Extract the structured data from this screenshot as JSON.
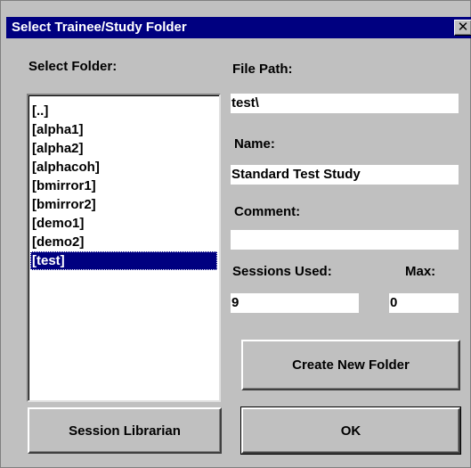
{
  "window": {
    "title": "Select Trainee/Study Folder",
    "close_glyph": "✕"
  },
  "folder_panel": {
    "label": "Select Folder:",
    "items": [
      "[..]",
      "[alpha1]",
      "[alpha2]",
      "[alphacoh]",
      "[bmirror1]",
      "[bmirror2]",
      "[demo1]",
      "[demo2]",
      "[test]"
    ],
    "selected": "[test]"
  },
  "details": {
    "file_path_label": "File Path:",
    "file_path_value": "test\\",
    "name_label": "Name:",
    "name_value": "Standard Test Study",
    "comment_label": "Comment:",
    "comment_value": "",
    "sessions_used_label": "Sessions Used:",
    "sessions_used_value": "9",
    "max_label": "Max:",
    "max_value": "0"
  },
  "buttons": {
    "create_new_folder": "Create New Folder",
    "session_librarian": "Session Librarian",
    "ok": "OK"
  },
  "colors": {
    "title_bar": "#000080",
    "dialog_face": "#c0c0c0",
    "selection": "#000080"
  }
}
